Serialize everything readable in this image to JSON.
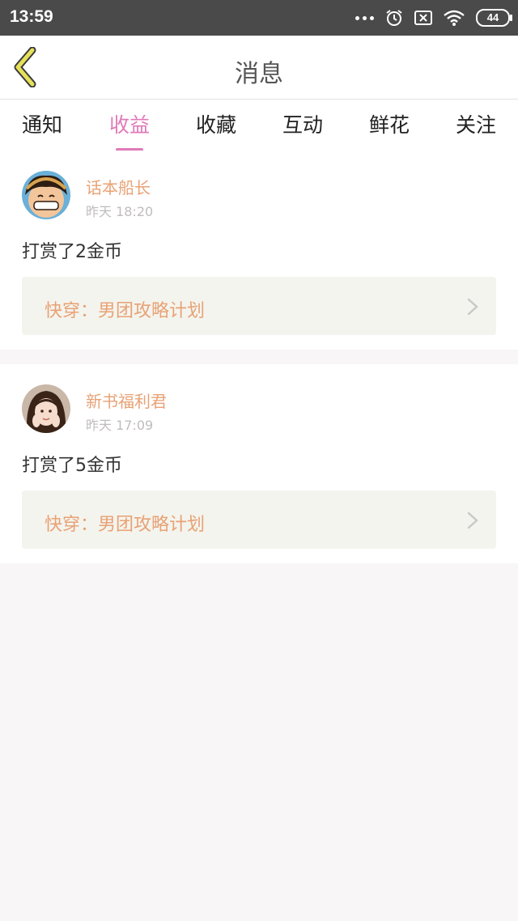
{
  "status_bar": {
    "time": "13:59",
    "battery": "44",
    "icons": [
      "more-dots-icon",
      "alarm-icon",
      "no-sim-icon",
      "wifi-icon",
      "battery-icon"
    ]
  },
  "header": {
    "title": "消息",
    "back_icon": "back-chevron-icon"
  },
  "tabs": [
    {
      "label": "通知",
      "active": false
    },
    {
      "label": "收益",
      "active": true
    },
    {
      "label": "收藏",
      "active": false
    },
    {
      "label": "互动",
      "active": false
    },
    {
      "label": "鲜花",
      "active": false
    },
    {
      "label": "关注",
      "active": false
    }
  ],
  "messages": [
    {
      "author": "话本船长",
      "time": "昨天 18:20",
      "text": "打赏了2金币",
      "book": "快穿：男团攻略计划"
    },
    {
      "author": "新书福利君",
      "time": "昨天 17:09",
      "text": "打赏了5金币",
      "book": "快穿：男团攻略计划"
    }
  ],
  "colors": {
    "accent": "#e07ab9",
    "author": "#e8a275",
    "status_bar": "#4a4a4a",
    "back_icon_fill": "#e6e05a"
  }
}
